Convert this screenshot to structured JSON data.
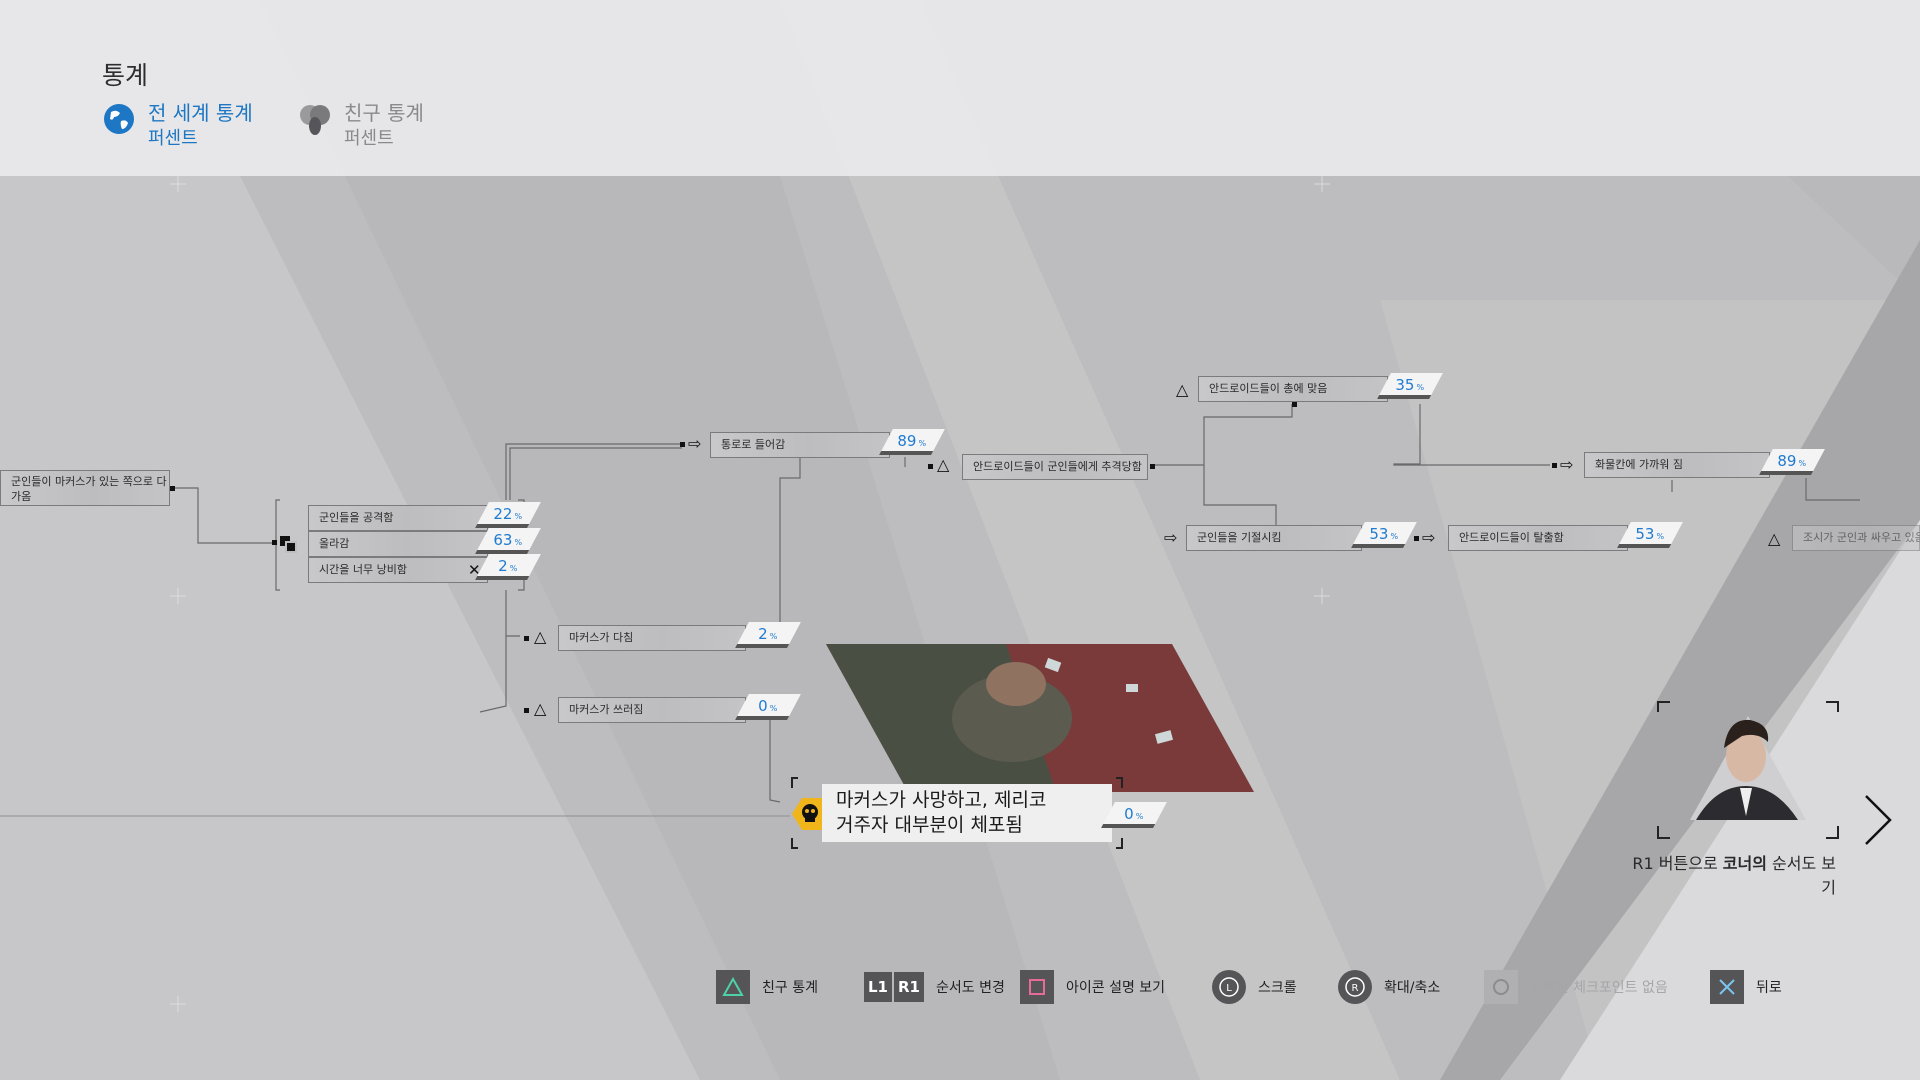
{
  "header": {
    "title": "통계",
    "tabs": [
      {
        "label": "전 세계 통계",
        "sub": "퍼센트",
        "active": true,
        "color": "#1d77c4",
        "icon": "globe-icon"
      },
      {
        "label": "친구 통계",
        "sub": "퍼센트",
        "active": false,
        "color": "#8a8a8c",
        "icon": "friends-icon"
      }
    ]
  },
  "flowchart": {
    "left_node": "군인들이 마커스가 있는 쪽으로 다가옴",
    "choices": [
      {
        "label": "군인들을 공격함",
        "percent": "22"
      },
      {
        "label": "올라감",
        "percent": "63"
      },
      {
        "label": "시간을 너무 낭비함",
        "percent": "2"
      }
    ],
    "path_node": {
      "label": "통로로 들어감",
      "percent": "89"
    },
    "pursued_node": {
      "label": "안드로이드들이 군인들에게 추격당함"
    },
    "hurt_node": {
      "label": "마커스가 다침",
      "percent": "2"
    },
    "fell_node": {
      "label": "마커스가 쓰러짐",
      "percent": "0"
    },
    "shot_node": {
      "label": "안드로이드들이 총에 맞음",
      "percent": "35"
    },
    "surprise_node": {
      "label": "군인들을 기절시킴",
      "percent": "53"
    },
    "escape_node": {
      "label": "안드로이드들이 탈출함",
      "percent": "53"
    },
    "cargo_node": {
      "label": "화물칸에 가까워 짐",
      "percent": "89"
    },
    "partial_node": {
      "label": "조시가 군인과 싸우고 있음"
    },
    "ending_node": {
      "line1": "마커스가 사망하고, 제리코",
      "line2": "거주자 대부분이 체포됨",
      "percent": "0"
    },
    "percent_unit": "%"
  },
  "connor_panel": {
    "text_pre": "R1 버튼으로 ",
    "text_bold": "코너의",
    "text_post": " 순서도 보기"
  },
  "controls": [
    {
      "glyph": "triangle-icon",
      "label": "친구 통계"
    },
    {
      "glyph": "L1 R1",
      "l1": "L1",
      "r1": "R1",
      "label": "순서도 변경"
    },
    {
      "glyph": "square-icon",
      "label": "아이콘 설명 보기"
    },
    {
      "glyph": "left-stick-icon",
      "stick": "L",
      "label": "스크롤"
    },
    {
      "glyph": "right-stick-icon",
      "stick": "R",
      "label": "확대/축소"
    },
    {
      "glyph": "circle-icon",
      "label": "선택된 체크포인트 없음",
      "disabled": true
    },
    {
      "glyph": "cross-icon",
      "label": "뒤로"
    }
  ],
  "colors": {
    "accent": "#1d77c4",
    "percent": "#1f7bd0"
  }
}
